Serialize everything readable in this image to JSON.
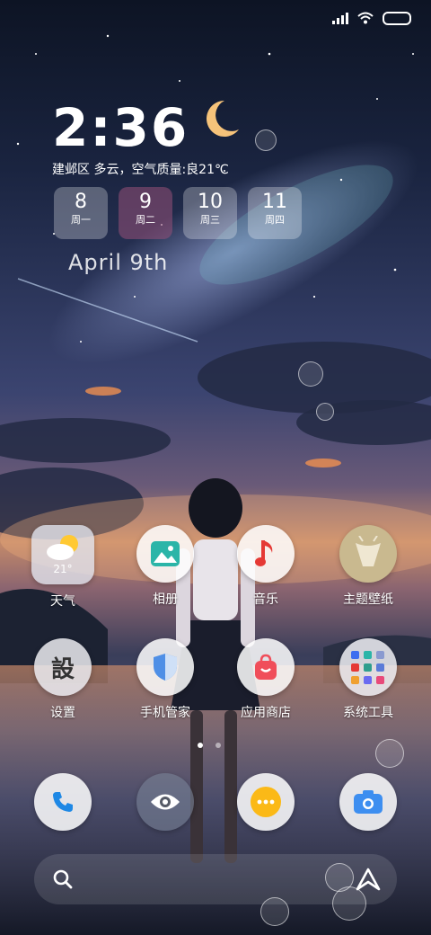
{
  "status_bar": {
    "signal_icon": "signal-bars-icon",
    "wifi_icon": "wifi-icon",
    "battery_icon": "battery-icon"
  },
  "clock": {
    "time": "2:36"
  },
  "weather_line": "建邺区 多云，空气质量:良21℃",
  "days": [
    {
      "num": "8",
      "weekday": "周一"
    },
    {
      "num": "9",
      "weekday": "周二"
    },
    {
      "num": "10",
      "weekday": "周三"
    },
    {
      "num": "11",
      "weekday": "周四"
    }
  ],
  "date_text": "April  9th",
  "apps_row1": [
    {
      "label": "天气",
      "icon": "weather-icon",
      "temp": "21°"
    },
    {
      "label": "相册",
      "icon": "gallery-icon"
    },
    {
      "label": "音乐",
      "icon": "music-icon"
    },
    {
      "label": "主题壁纸",
      "icon": "themes-icon"
    }
  ],
  "apps_row2": [
    {
      "label": "设置",
      "icon": "settings-icon",
      "glyph": "設"
    },
    {
      "label": "手机管家",
      "icon": "security-icon"
    },
    {
      "label": "应用商店",
      "icon": "app-store-icon"
    },
    {
      "label": "系统工具",
      "icon": "system-tools-folder-icon"
    }
  ],
  "dock": [
    {
      "icon": "phone-icon"
    },
    {
      "icon": "browser-eye-icon"
    },
    {
      "icon": "messages-icon"
    },
    {
      "icon": "camera-icon"
    }
  ],
  "page_indicator": {
    "pages": 2,
    "current": 1
  },
  "search_bar": {
    "search_icon": "search-icon",
    "assistant_icon": "assistant-icon"
  },
  "colors": {
    "music_red": "#e53935",
    "gallery_teal": "#2bb5a8",
    "store_red": "#f04e5a",
    "phone_blue": "#1e88e5",
    "message_yellow": "#fbb917",
    "camera_blue": "#3d8ef0"
  }
}
